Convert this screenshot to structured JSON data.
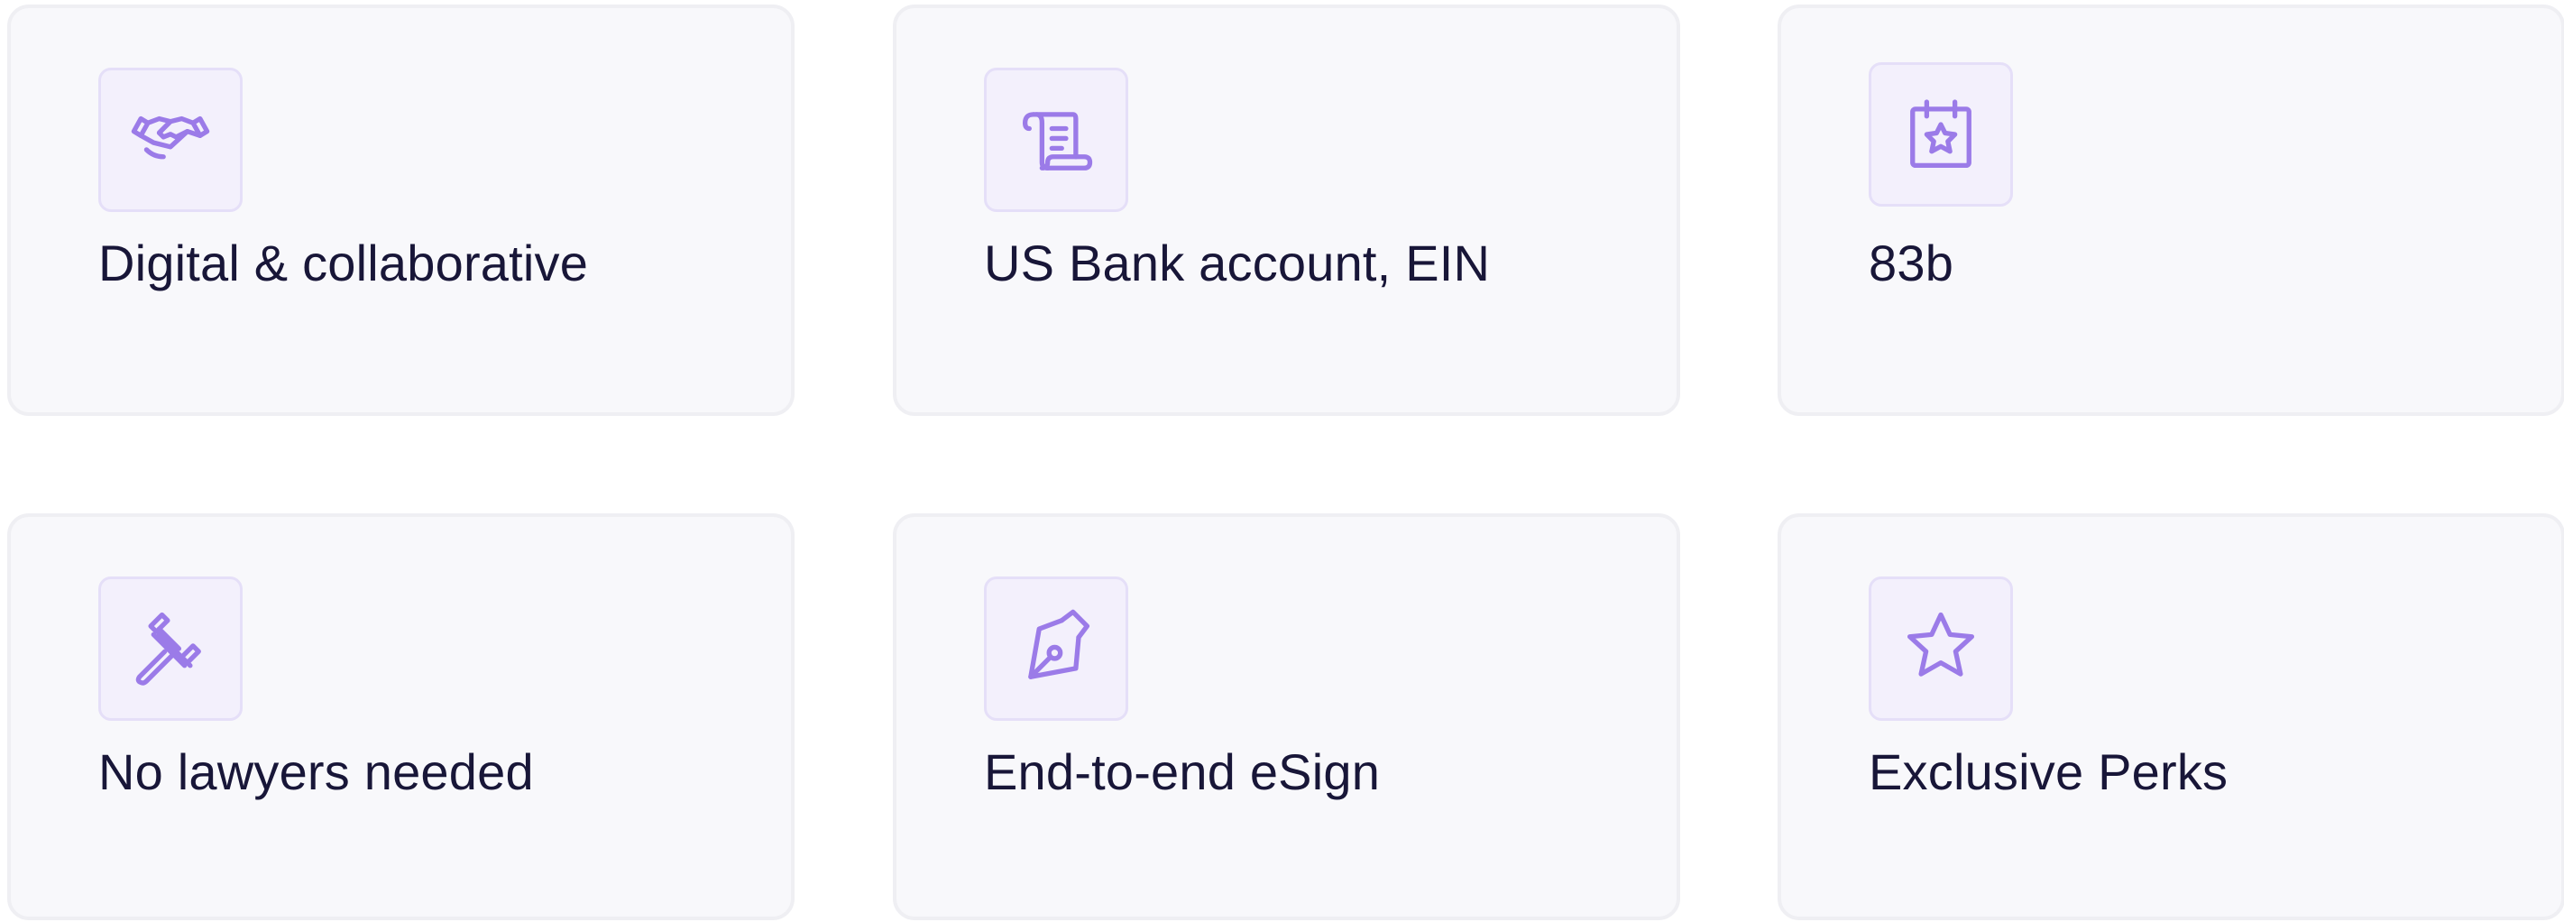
{
  "features": [
    {
      "label": "Digital & collaborative",
      "icon": "handshake-icon"
    },
    {
      "label": "US Bank account, EIN",
      "icon": "scroll-icon"
    },
    {
      "label": "83b",
      "icon": "calendar-star-icon"
    },
    {
      "label": "No lawyers needed",
      "icon": "gavel-icon"
    },
    {
      "label": "End-to-end eSign",
      "icon": "pen-nib-icon"
    },
    {
      "label": "Exclusive Perks",
      "icon": "star-icon"
    }
  ],
  "colors": {
    "card_background": "#f8f8fb",
    "card_border": "#efeff3",
    "icon_tile": "#f3f0fc",
    "icon_stroke": "#9b7be8",
    "text": "#181638"
  }
}
